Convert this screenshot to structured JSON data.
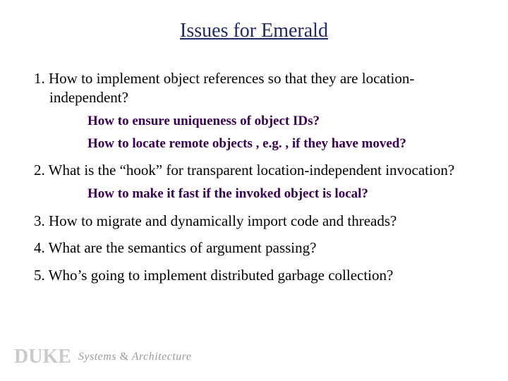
{
  "title": "Issues for Emerald",
  "items": {
    "i1": {
      "num": "1.",
      "text": "How to implement object references so that they are location-independent?",
      "subs": {
        "a": "How to ensure uniqueness of object IDs?",
        "b": "How to locate remote objects , e.g. , if they have moved?"
      }
    },
    "i2": {
      "num": "2.",
      "text": "What is the “hook” for transparent location-independent invocation?",
      "subs": {
        "a": "How to make it fast if the invoked object is local?"
      }
    },
    "i3": {
      "num": "3.",
      "text": "How to migrate and dynamically import code and threads?"
    },
    "i4": {
      "num": "4.",
      "text": "What are the semantics of argument passing?"
    },
    "i5": {
      "num": "5.",
      "text": "Who’s going to implement distributed garbage collection?"
    }
  },
  "footer": {
    "logo": "DUKE",
    "text_before": "Systems ",
    "amp": "&",
    "text_after": " Architecture"
  }
}
